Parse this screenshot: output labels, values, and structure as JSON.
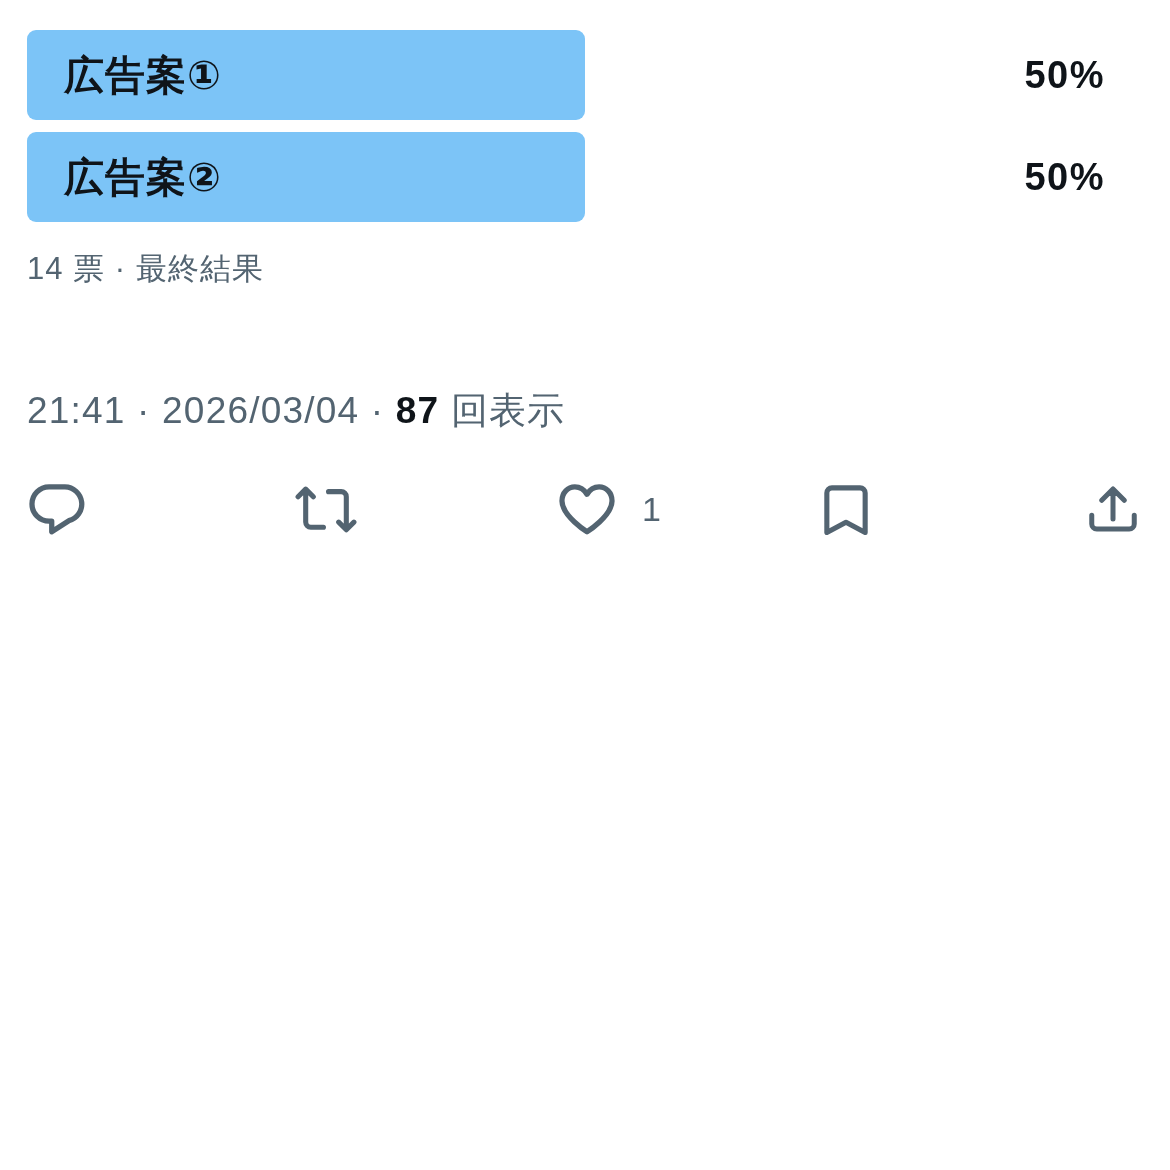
{
  "poll": {
    "options": [
      {
        "label": "広告案①",
        "percent": "50%",
        "level": 0.5
      },
      {
        "label": "広告案②",
        "percent": "50%",
        "level": 0.5
      }
    ],
    "summary": "14 票 · 最終結果"
  },
  "meta": "21:41 · 2026/03/04 · **87** 回表示",
  "actions": [
    {
      "kind": "reply"
    },
    {
      "kind": "repost"
    },
    {
      "kind": "like",
      "count": "1"
    },
    {
      "kind": "bookmark"
    },
    {
      "kind": "share"
    }
  ]
}
